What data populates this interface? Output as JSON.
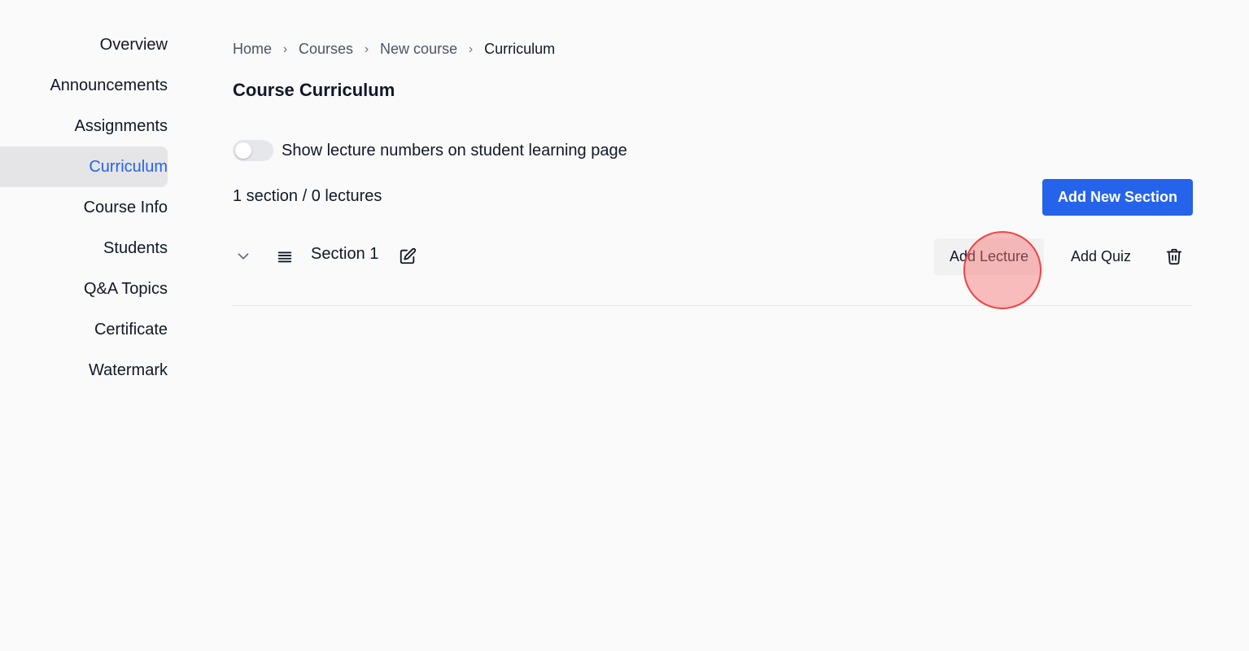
{
  "sidebar": {
    "items": [
      {
        "label": "Overview",
        "active": false
      },
      {
        "label": "Announcements",
        "active": false
      },
      {
        "label": "Assignments",
        "active": false
      },
      {
        "label": "Curriculum",
        "active": true
      },
      {
        "label": "Course Info",
        "active": false
      },
      {
        "label": "Students",
        "active": false
      },
      {
        "label": "Q&A Topics",
        "active": false
      },
      {
        "label": "Certificate",
        "active": false
      },
      {
        "label": "Watermark",
        "active": false
      }
    ]
  },
  "breadcrumb": {
    "items": [
      "Home",
      "Courses",
      "New course",
      "Curriculum"
    ],
    "separator": "›"
  },
  "page": {
    "title": "Course Curriculum"
  },
  "settings": {
    "show_lecture_numbers_label": "Show lecture numbers on student learning page",
    "show_lecture_numbers_on": false
  },
  "curriculum": {
    "summary": "1 section / 0 lectures",
    "add_section_label": "Add New Section",
    "sections": [
      {
        "title": "Section 1",
        "add_lecture_label": "Add Lecture",
        "add_quiz_label": "Add Quiz"
      }
    ]
  },
  "icons": {
    "chevron": "chevron-down-icon",
    "drag": "drag-handle-icon",
    "edit": "edit-icon",
    "delete": "trash-icon"
  },
  "colors": {
    "accent": "#2563eb",
    "background": "#fafafa",
    "active_item_bg": "#e5e5e8",
    "click_indicator": "#ef4444"
  }
}
